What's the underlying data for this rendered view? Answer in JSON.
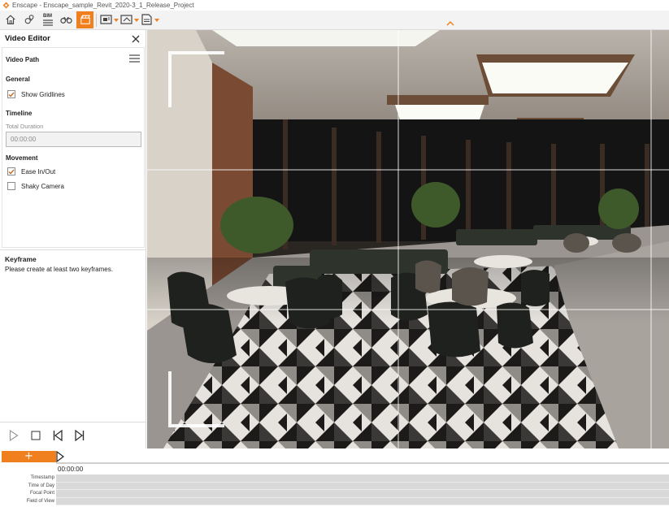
{
  "window": {
    "title": "Enscape - Enscape_sample_Revit_2020-3_1_Release_Project"
  },
  "toolbar": {
    "buttons": [
      {
        "name": "home-icon"
      },
      {
        "name": "map-pin-icon"
      },
      {
        "name": "bim-icon",
        "label": "BIM"
      },
      {
        "name": "binoculars-icon"
      },
      {
        "name": "video-editor-icon"
      }
    ],
    "active_color": "#f07f1d"
  },
  "panel": {
    "title": "Video Editor",
    "video_path_title": "Video Path",
    "general": {
      "title": "General",
      "show_gridlines_label": "Show Gridlines",
      "show_gridlines_checked": true
    },
    "timeline": {
      "title": "Timeline",
      "total_duration_label": "Total Duration",
      "total_duration_value": "00:00:00"
    },
    "movement": {
      "title": "Movement",
      "ease_label": "Ease In/Out",
      "ease_checked": true,
      "shaky_label": "Shaky Camera",
      "shaky_checked": false
    },
    "keyframe": {
      "title": "Keyframe",
      "message": "Please create at least two keyframes."
    }
  },
  "timeline_bar": {
    "add_label": "+",
    "time": "00:00:00",
    "tracks": [
      "Timestamp",
      "Time of Day",
      "Focal Point",
      "Field of View"
    ]
  },
  "colors": {
    "accent": "#f07f1d",
    "check": "#c8691a"
  }
}
